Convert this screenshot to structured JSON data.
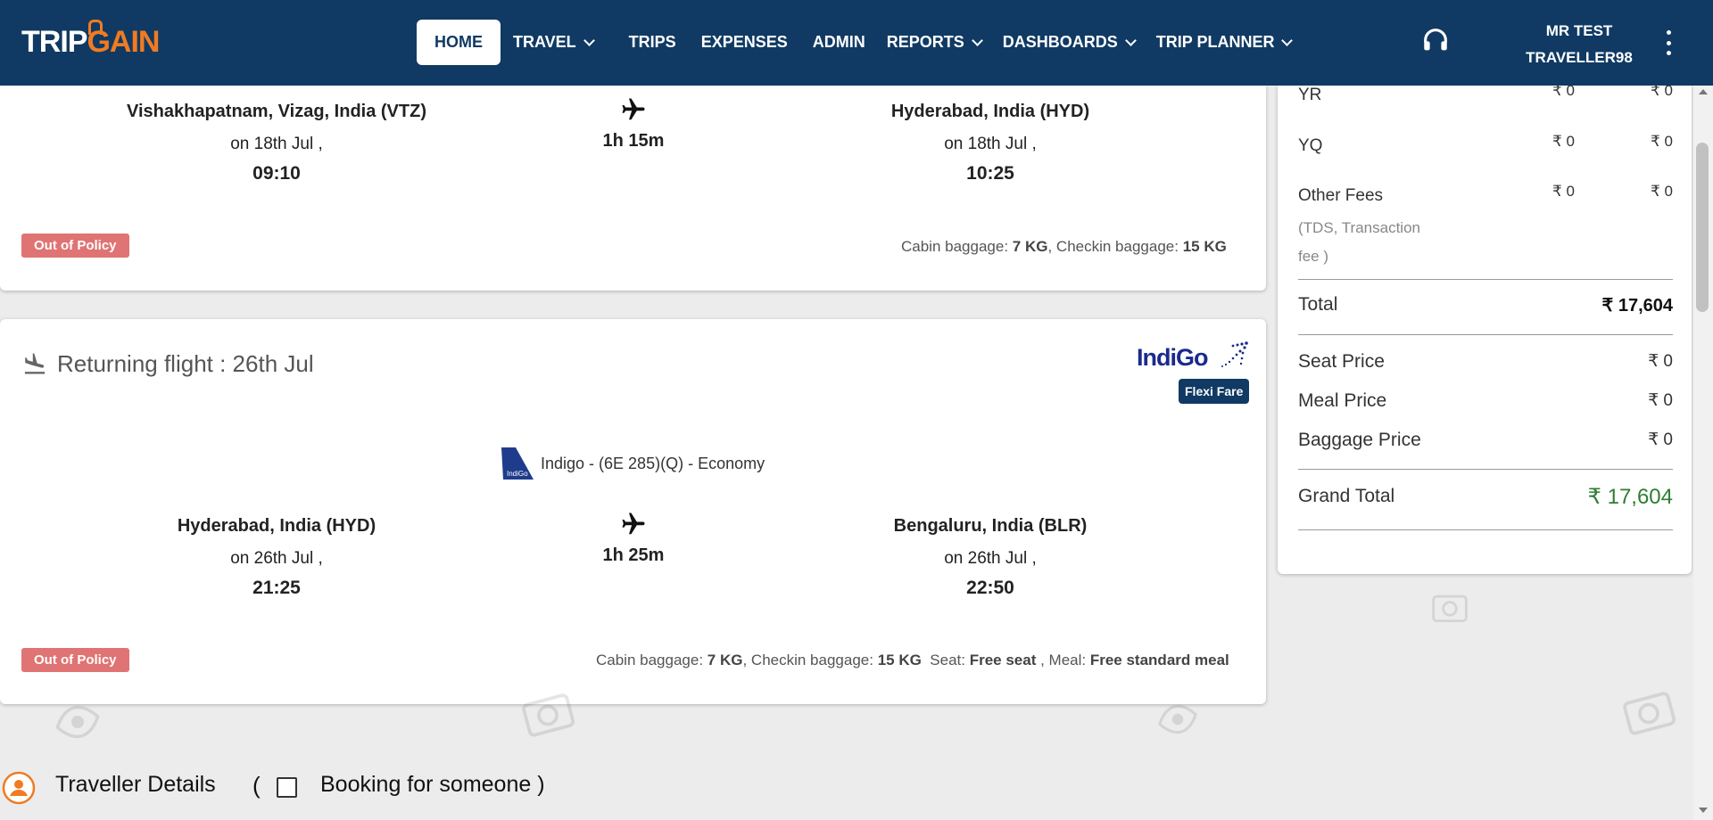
{
  "navbar": {
    "logo_trip": "TRIP",
    "logo_gain": "GAIN",
    "items": [
      {
        "label": "HOME",
        "active": true,
        "dropdown": false
      },
      {
        "label": "TRAVEL",
        "active": false,
        "dropdown": true
      },
      {
        "label": "TRIPS",
        "active": false,
        "dropdown": false
      },
      {
        "label": "EXPENSES",
        "active": false,
        "dropdown": false
      },
      {
        "label": "ADMIN",
        "active": false,
        "dropdown": false
      },
      {
        "label": "REPORTS",
        "active": false,
        "dropdown": true
      },
      {
        "label": "DASHBOARDS",
        "active": false,
        "dropdown": true
      },
      {
        "label": "TRIP PLANNER",
        "active": false,
        "dropdown": true
      }
    ],
    "user_line1": "MR TEST",
    "user_line2": "TRAVELLER98",
    "support_icon": "headphones-icon",
    "menu_icon": "kebab-icon"
  },
  "onward": {
    "from_city": "Vishakhapatnam, Vizag, India (VTZ)",
    "from_date": "on 18th Jul ,",
    "from_time": "09:10",
    "duration": "1h 15m",
    "to_city": "Hyderabad, India (HYD)",
    "to_date": "on 18th Jul ,",
    "to_time": "10:25",
    "policy_badge": "Out of Policy",
    "cabin_label": "Cabin baggage: ",
    "cabin_value": "7 KG",
    "checkin_label": ", Checkin baggage: ",
    "checkin_value": "15 KG"
  },
  "returning": {
    "title": "Returning flight : 26th Jul",
    "airline_logo_text": "IndiGo",
    "fare_type": "Flexi Fare",
    "airline_info": "Indigo - (6E 285)(Q) - Economy",
    "from_city": "Hyderabad, India (HYD)",
    "from_date": "on 26th Jul ,",
    "from_time": "21:25",
    "duration": "1h 25m",
    "to_city": "Bengaluru, India (BLR)",
    "to_date": "on 26th Jul ,",
    "to_time": "22:50",
    "policy_badge": "Out of Policy",
    "cabin_label": "Cabin baggage: ",
    "cabin_value": "7 KG",
    "checkin_label": ", Checkin baggage: ",
    "checkin_value": "15 KG",
    "seat_label": "Seat: ",
    "seat_value": "Free seat",
    "meal_label": " , Meal: ",
    "meal_value": "Free standard meal"
  },
  "fare": {
    "yr_label": "YR",
    "yr_v1": "₹ 0",
    "yr_v2": "₹ 0",
    "yq_label": "YQ",
    "yq_v1": "₹ 0",
    "yq_v2": "₹ 0",
    "other_label": "Other Fees",
    "other_sub": "(TDS, Transaction fee )",
    "other_v1": "₹ 0",
    "other_v2": "₹ 0",
    "total_label": "Total",
    "total_value": "₹ 17,604",
    "seat_label": "Seat Price",
    "seat_value": "₹ 0",
    "meal_label": "Meal Price",
    "meal_value": "₹ 0",
    "baggage_label": "Baggage Price",
    "baggage_value": "₹ 0",
    "grand_label": "Grand Total",
    "grand_value": "₹ 17,604",
    "grand_color": "#2e7d32"
  },
  "traveller": {
    "title": "Traveller Details",
    "open_paren": "(",
    "booking_label": "Booking for someone )"
  },
  "colors": {
    "navbar": "#103a63",
    "accent_orange": "#f07b22",
    "policy_red": "#e07373"
  }
}
